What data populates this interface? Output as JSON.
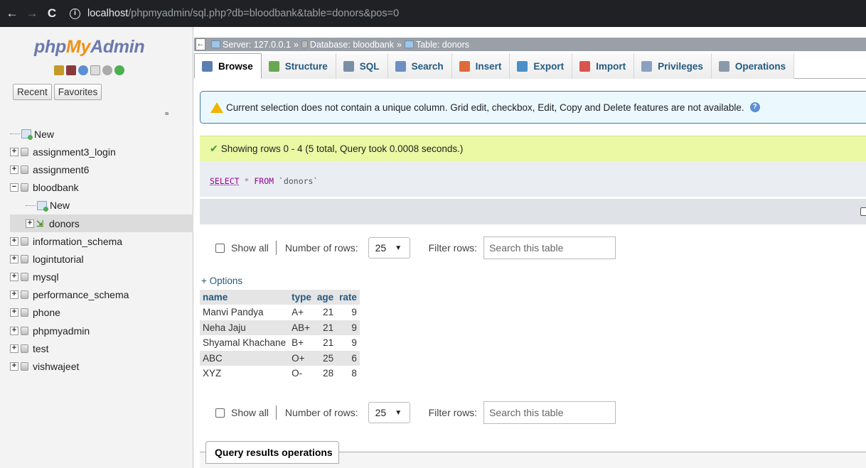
{
  "browser": {
    "url_host": "localhost",
    "url_path": "/phpmyadmin/sql.php?db=bloodbank&table=donors&pos=0"
  },
  "sidebar": {
    "logo": {
      "php": "php",
      "my": "My",
      "admin": "Admin"
    },
    "tabs": [
      "Recent",
      "Favorites"
    ],
    "tree": [
      {
        "label": "New",
        "kind": "new",
        "level": 0
      },
      {
        "label": "assignment3_login",
        "kind": "db",
        "level": 0
      },
      {
        "label": "assignment6",
        "kind": "db",
        "level": 0
      },
      {
        "label": "bloodbank",
        "kind": "db-open",
        "level": 0
      },
      {
        "label": "New",
        "kind": "new",
        "level": 1
      },
      {
        "label": "donors",
        "kind": "table",
        "level": 1,
        "selected": true
      },
      {
        "label": "information_schema",
        "kind": "db",
        "level": 0
      },
      {
        "label": "logintutorial",
        "kind": "db",
        "level": 0
      },
      {
        "label": "mysql",
        "kind": "db",
        "level": 0
      },
      {
        "label": "performance_schema",
        "kind": "db",
        "level": 0
      },
      {
        "label": "phone",
        "kind": "db",
        "level": 0
      },
      {
        "label": "phpmyadmin",
        "kind": "db",
        "level": 0
      },
      {
        "label": "test",
        "kind": "db",
        "level": 0
      },
      {
        "label": "vishwajeet",
        "kind": "db",
        "level": 0
      }
    ]
  },
  "breadcrumb": {
    "server": "Server: 127.0.0.1",
    "database": "Database: bloodbank",
    "table": "Table: donors",
    "separator": "»"
  },
  "tabs": [
    {
      "label": "Browse",
      "color": "#5b7fb0"
    },
    {
      "label": "Structure",
      "color": "#6aa84f"
    },
    {
      "label": "SQL",
      "color": "#7a8ea8"
    },
    {
      "label": "Search",
      "color": "#6d8fc4"
    },
    {
      "label": "Insert",
      "color": "#e06b3a"
    },
    {
      "label": "Export",
      "color": "#4a8fc9"
    },
    {
      "label": "Import",
      "color": "#d9534f"
    },
    {
      "label": "Privileges",
      "color": "#8aa0c0"
    },
    {
      "label": "Operations",
      "color": "#8a9aa8"
    }
  ],
  "notice": "Current selection does not contain a unique column. Grid edit, checkbox, Edit, Copy and Delete features are not available.",
  "success": "Showing rows 0 - 4 (5 total, Query took 0.0008 seconds.)",
  "sql": {
    "select": "SELECT",
    "star": "*",
    "from": "FROM",
    "table": "`donors`"
  },
  "nav": {
    "show_all": "Show all",
    "rows_label": "Number of rows:",
    "rows_value": "25",
    "filter_label": "Filter rows:",
    "filter_placeholder": "Search this table"
  },
  "options_link": "+ Options",
  "table": {
    "headers": [
      "name",
      "type",
      "age",
      "rate"
    ],
    "rows": [
      [
        "Manvi Pandya",
        "A+",
        "21",
        "9"
      ],
      [
        "Neha Jaju",
        "AB+",
        "21",
        "9"
      ],
      [
        "Shyamal Khachane",
        "B+",
        "21",
        "9"
      ],
      [
        "ABC",
        "O+",
        "25",
        "6"
      ],
      [
        "XYZ",
        "O-",
        "28",
        "8"
      ]
    ]
  },
  "query_results_ops": "Query results operations"
}
